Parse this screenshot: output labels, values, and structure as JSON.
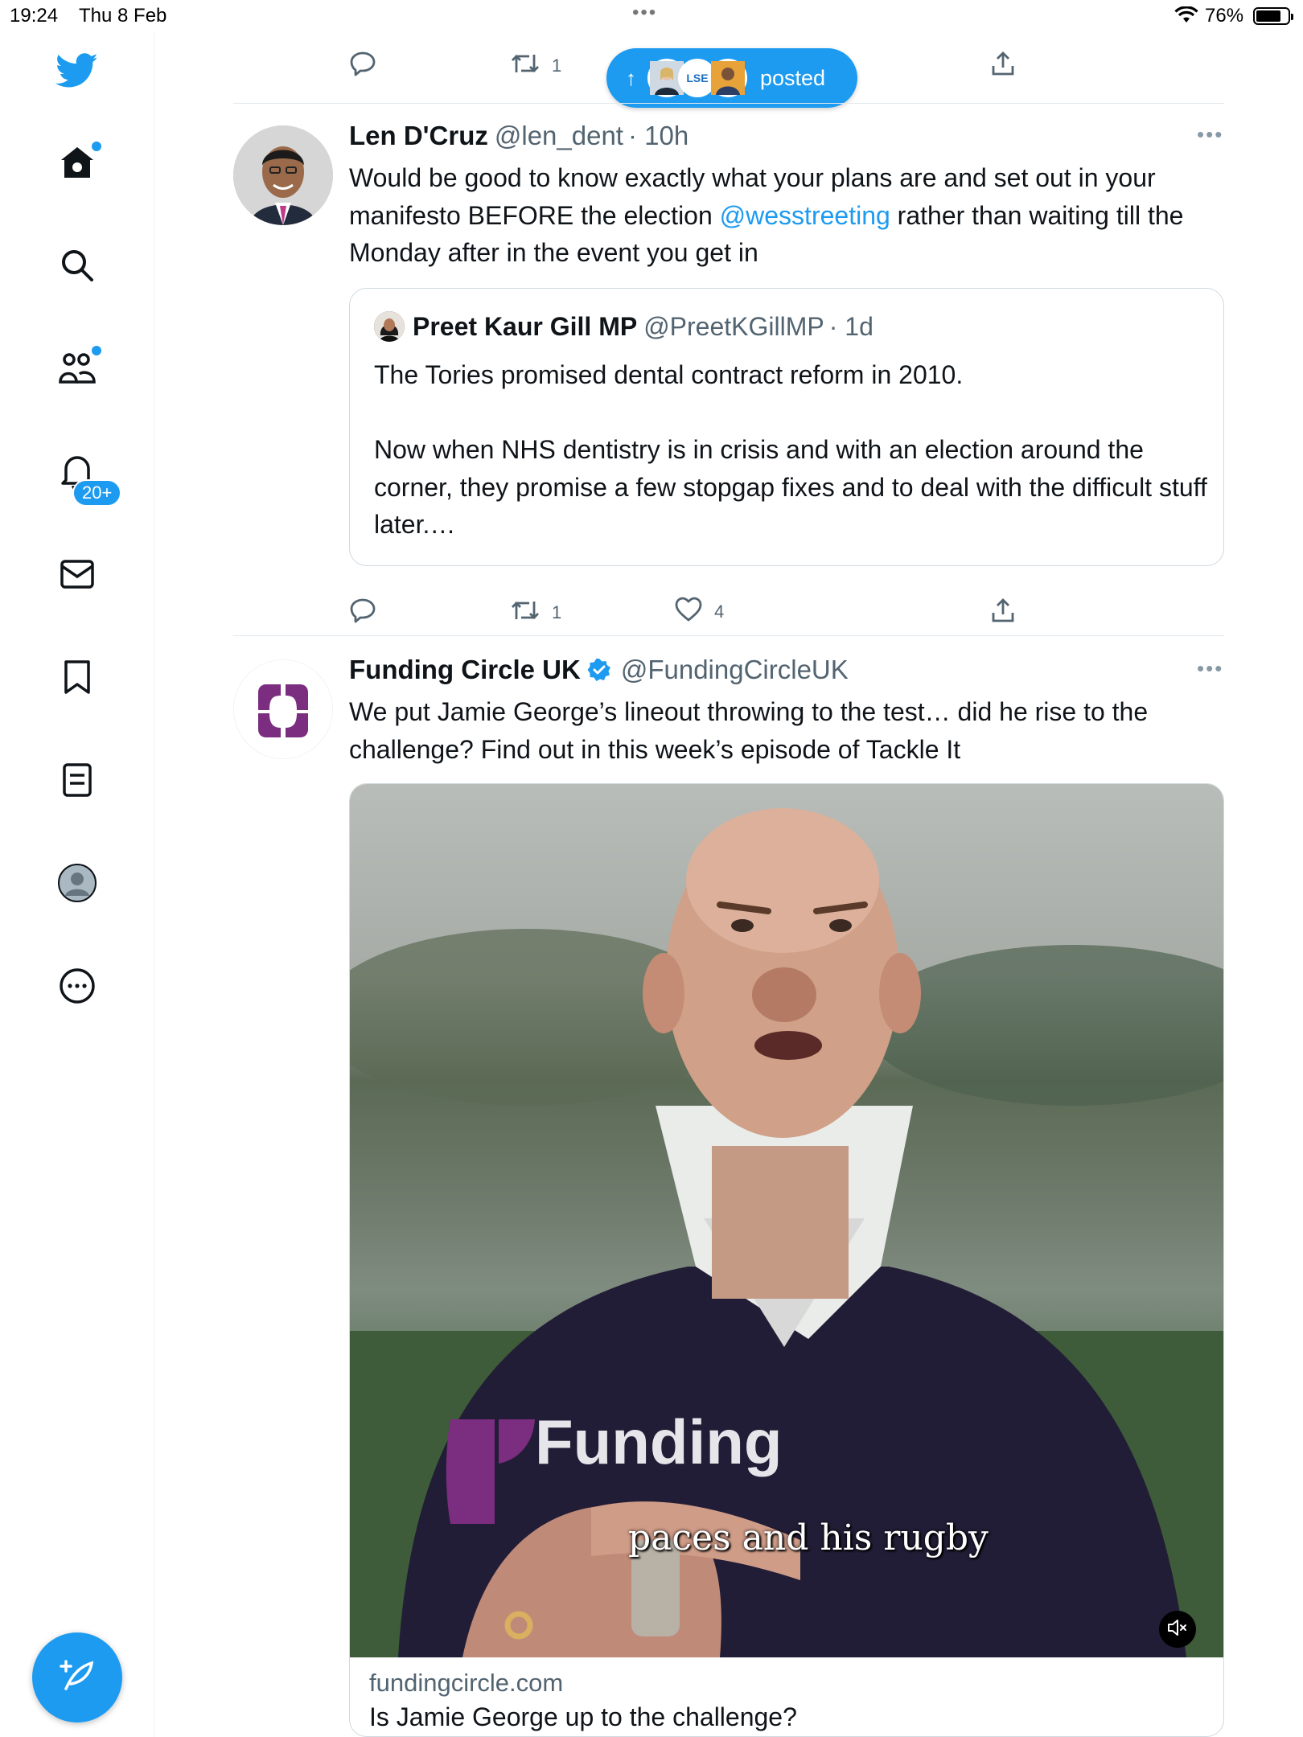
{
  "status_bar": {
    "time": "19:24",
    "date": "Thu 8 Feb",
    "battery_percent": "76%",
    "battery_level": 0.76
  },
  "sidebar": {
    "items": [
      {
        "name": "home",
        "icon": "home-icon"
      },
      {
        "name": "search",
        "icon": "search-icon"
      },
      {
        "name": "communities",
        "icon": "communities-icon"
      },
      {
        "name": "notifications",
        "icon": "bell-icon",
        "badge": "20+"
      },
      {
        "name": "messages",
        "icon": "mail-icon"
      },
      {
        "name": "bookmarks",
        "icon": "bookmark-icon"
      },
      {
        "name": "lists",
        "icon": "lists-icon"
      },
      {
        "name": "profile",
        "icon": "profile-avatar-icon"
      },
      {
        "name": "more",
        "icon": "more-circle-icon"
      }
    ],
    "compose_icon": "compose-feather-icon",
    "accent": "#1d9bf0"
  },
  "new_posts_pill": {
    "label": "posted",
    "avatar_text": "LSE"
  },
  "top_actions": {
    "retweets": "1"
  },
  "tweets": [
    {
      "name": "Len D'Cruz",
      "handle": "@len_dent",
      "time": "· 10h",
      "text_before": "Would be good to know exactly what your plans are and set out in your manifesto  BEFORE the election ",
      "mention": "@wesstreeting",
      "text_after": " rather than waiting till the Monday after in the event you get in",
      "quote": {
        "name": "Preet Kaur Gill MP",
        "handle": "@PreetKGillMP",
        "time": "· 1d",
        "para1": "The Tories promised dental contract reform in 2010.",
        "para2": "Now when NHS dentistry is in crisis and with an election around the corner, they promise a few stopgap fixes and to deal with the difficult stuff later.…"
      },
      "retweets": "1",
      "likes": "4"
    },
    {
      "name": "Funding Circle UK",
      "handle": "@FundingCircleUK",
      "verified": true,
      "text": "We put Jamie George’s lineout throwing to the test… did he rise to the challenge? Find out in this week’s episode of Tackle It",
      "media": {
        "shirt_text": "Funding",
        "caption": "paces and his rugby",
        "card_domain": "fundingcircle.com",
        "card_title": "Is Jamie George up to the challenge?"
      },
      "brand_color": "#7b2d7f"
    }
  ]
}
